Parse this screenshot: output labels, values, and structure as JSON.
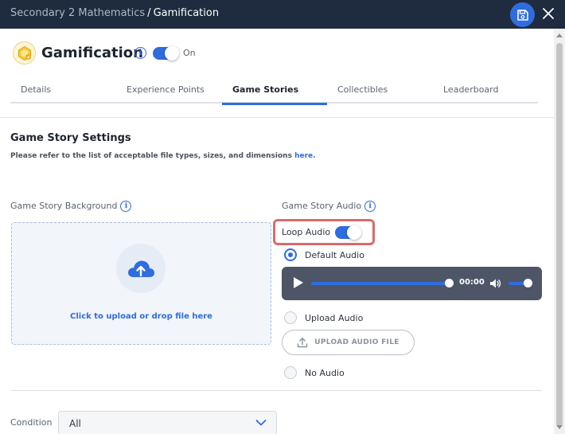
{
  "header": {
    "breadcrumb_parent": "Secondary 2 Mathematics",
    "breadcrumb_separator": "/",
    "breadcrumb_current": "Gamification",
    "save_icon": "floppy-disk-icon",
    "close_icon": "close-icon"
  },
  "page": {
    "title": "Gamification",
    "status_label": "On",
    "toggle_on": true,
    "logo_icon": "gamification-badge-icon"
  },
  "tabs": [
    {
      "label": "Details",
      "active": false
    },
    {
      "label": "Experience Points",
      "active": false
    },
    {
      "label": "Game Stories",
      "active": true
    },
    {
      "label": "Collectibles",
      "active": false
    },
    {
      "label": "Leaderboard",
      "active": false
    }
  ],
  "settings": {
    "section_title": "Game Story Settings",
    "note_prefix": "Please refer to the list of acceptable file types, sizes, and dimensions",
    "note_link": "here.",
    "background": {
      "label": "Game Story Background",
      "drop_text": "Click to upload or drop file here"
    },
    "audio": {
      "label": "Game Story Audio",
      "loop_label": "Loop Audio",
      "loop_on": true,
      "options": [
        {
          "label": "Default Audio",
          "checked": true
        },
        {
          "label": "Upload Audio",
          "checked": false
        },
        {
          "label": "No Audio",
          "checked": false
        }
      ],
      "player_time": "00:00",
      "upload_button": "UPLOAD AUDIO FILE"
    },
    "condition": {
      "label": "Condition",
      "value": "All"
    }
  },
  "colors": {
    "accent": "#2f6cde",
    "title_bar": "#1f2b3f",
    "highlight_border": "#d96b6b",
    "player_bg": "#4d5567"
  }
}
